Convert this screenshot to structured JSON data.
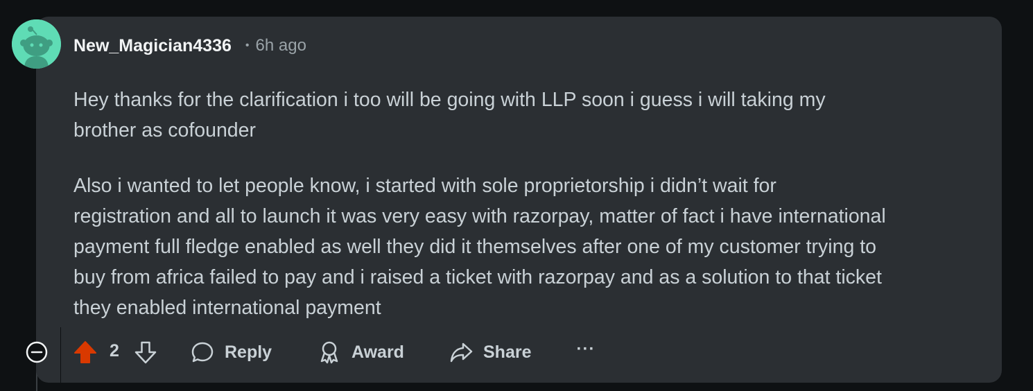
{
  "comment": {
    "username": "New_Magician4336",
    "separator": "•",
    "timestamp": "6h ago",
    "paragraphs": [
      {
        "lines": [
          "Hey thanks for the clarification i too will be going with LLP soon i guess i will taking my",
          "brother as cofounder"
        ]
      },
      {
        "lines": [
          "Also i wanted to let people know, i started with sole proprietorship i didn’t wait for",
          "registration and all to launch it was very easy with razorpay, matter of fact i have international",
          "payment full fledge enabled as well they did it themselves after one of my customer trying to",
          "buy from africa failed to pay and i raised a ticket with razorpay and as a solution to that ticket",
          "they enabled international payment"
        ]
      }
    ]
  },
  "actions": {
    "vote_count": "2",
    "upvote_active": true,
    "reply_label": "Reply",
    "award_label": "Award",
    "share_label": "Share",
    "more_label": "···"
  },
  "colors": {
    "card_bg": "#2b2f33",
    "page_bg": "#0e1113",
    "avatar_bg": "#5fdcb5",
    "upvote_active": "#d93900",
    "text_primary": "#f2f4f5",
    "text_secondary": "#9aa3a8",
    "text_body": "#c9d1d6"
  },
  "icons": {
    "avatar": "snoo-avatar-icon",
    "collapse": "collapse-minus-icon",
    "upvote": "upvote-arrow-icon",
    "downvote": "downvote-arrow-icon",
    "reply": "speech-bubble-icon",
    "award": "award-ribbon-icon",
    "share": "share-arrow-icon"
  }
}
